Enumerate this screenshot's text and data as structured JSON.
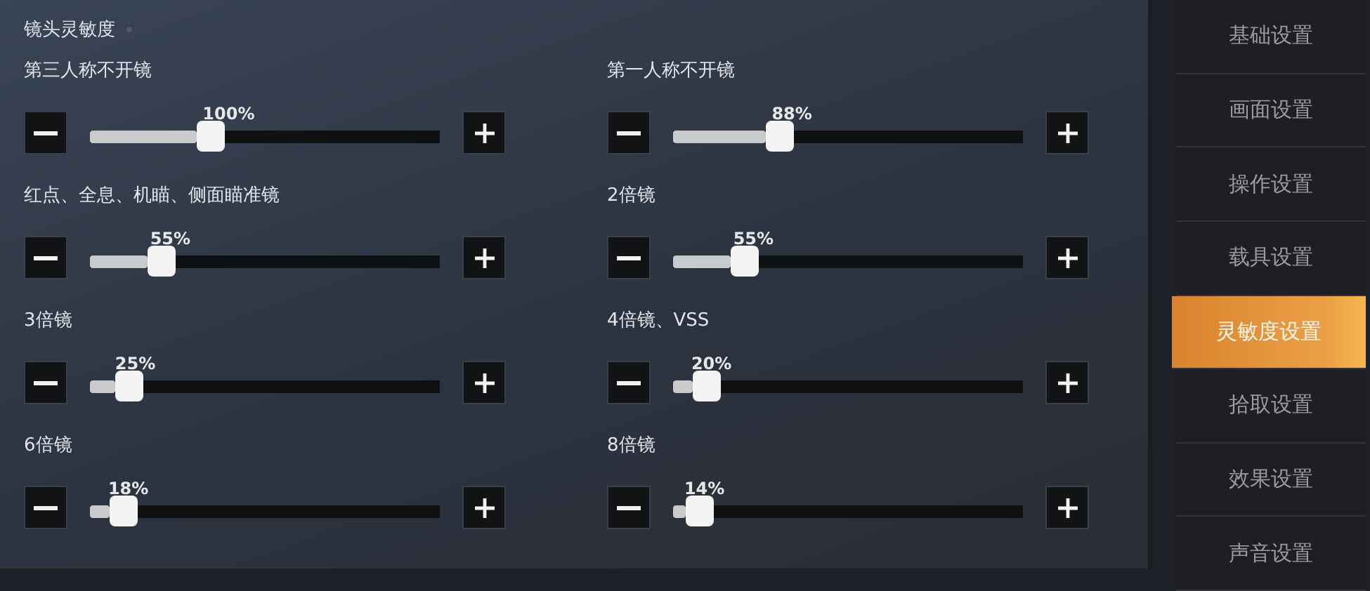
{
  "panel": {
    "title": "镜头灵敏度",
    "sliders": [
      {
        "label": "第三人称不开镜",
        "reading": "100%",
        "level": 0.33
      },
      {
        "label": "第一人称不开镜",
        "reading": "88%",
        "level": 0.29
      },
      {
        "label": "红点、全息、机瞄、侧面瞄准镜",
        "reading": "55%",
        "level": 0.18
      },
      {
        "label": "2倍镜",
        "reading": "55%",
        "level": 0.18
      },
      {
        "label": "3倍镜",
        "reading": "25%",
        "level": 0.08
      },
      {
        "label": "4倍镜、VSS",
        "reading": "20%",
        "level": 0.06
      },
      {
        "label": "6倍镜",
        "reading": "18%",
        "level": 0.06
      },
      {
        "label": "8倍镜",
        "reading": "14%",
        "level": 0.04
      }
    ]
  },
  "sidebar": {
    "items": [
      {
        "label": "基础设置",
        "selected": false
      },
      {
        "label": "画面设置",
        "selected": false
      },
      {
        "label": "操作设置",
        "selected": false
      },
      {
        "label": "载具设置",
        "selected": false
      },
      {
        "label": "灵敏度设置",
        "selected": true
      },
      {
        "label": "拾取设置",
        "selected": false
      },
      {
        "label": "效果设置",
        "selected": false
      },
      {
        "label": "声音设置",
        "selected": false
      }
    ]
  }
}
